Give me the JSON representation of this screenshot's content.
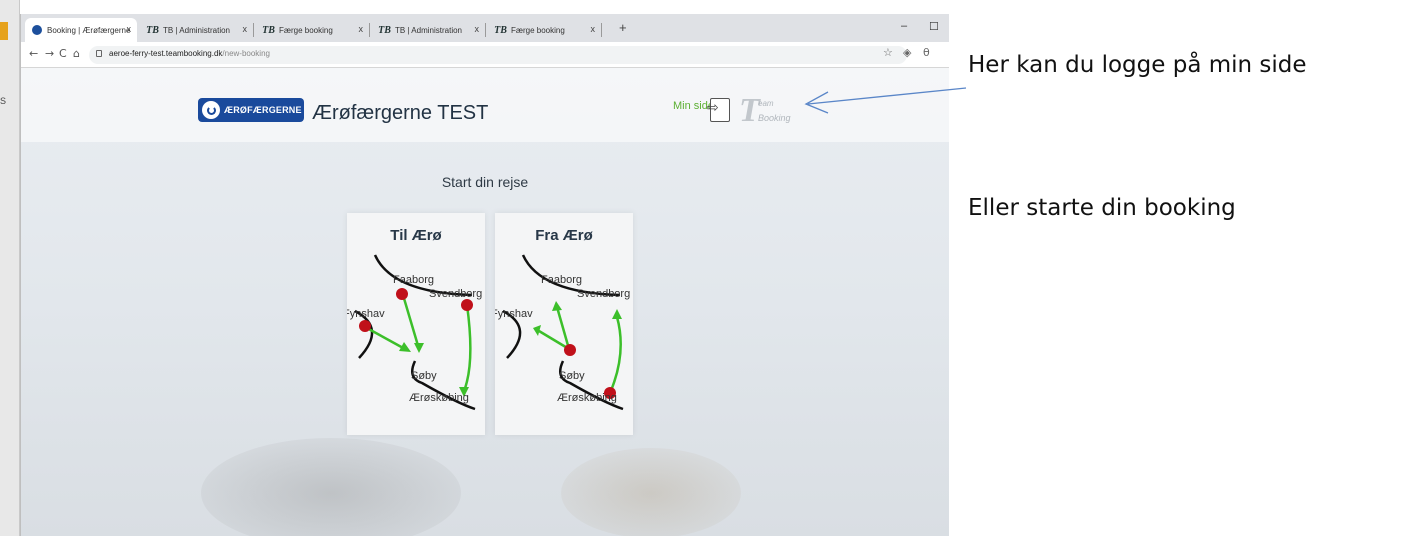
{
  "left_window": {
    "mark": "S"
  },
  "browser": {
    "tabs": [
      {
        "label": "Booking | Ærøfærgerne",
        "icon": "aerofaergerne-favicon",
        "close": "x"
      },
      {
        "label": "TB | Administration",
        "icon": "teambooking-favicon",
        "close": "x"
      },
      {
        "label": "Færge booking",
        "icon": "teambooking-favicon",
        "close": "x"
      },
      {
        "label": "TB | Administration",
        "icon": "teambooking-favicon",
        "close": "x"
      },
      {
        "label": "Færge booking",
        "icon": "teambooking-favicon",
        "close": "x"
      }
    ],
    "new_tab": "+",
    "window_controls": {
      "minimize": "–",
      "maximize": "☐"
    },
    "nav": {
      "back": "←",
      "forward": "→",
      "reload": "C",
      "home": "⌂"
    },
    "url": {
      "host": "aeroe-ferry-test.teambooking.dk",
      "path": "/new-booking"
    },
    "toolbar_icons": {
      "star": "☆",
      "extension": "◈",
      "profile": "θ"
    }
  },
  "page": {
    "brand_logo_text": "ÆRØFÆRGERNE",
    "site_title": "Ærøfærgerne TEST",
    "min_side_label": "Min side",
    "teambooking_logo": {
      "T": "T",
      "eam": "eam",
      "booking": "Booking"
    },
    "start_title": "Start din rejse",
    "cards": [
      {
        "title": "Til Ærø",
        "places": {
          "faaborg": "Faaborg",
          "svendborg": "Svendborg",
          "fynshav": "Fynshav",
          "soby": "Søby",
          "aeroskobing": "Ærøskøbing"
        }
      },
      {
        "title": "Fra Ærø",
        "places": {
          "faaborg": "Faaborg",
          "svendborg": "Svendborg",
          "fynshav": "Fynshav",
          "soby": "Søby",
          "aeroskobing": "Ærøskøbing"
        }
      }
    ]
  },
  "annotations": {
    "login_hint": "Her kan du logge på min side",
    "booking_hint": "Eller starte din booking"
  },
  "colors": {
    "brand_blue": "#1a4a9c",
    "accent_green": "#5cb032",
    "port_red": "#c0101a",
    "route_green": "#3cbf2a",
    "arrow_blue": "#5a86c8"
  }
}
